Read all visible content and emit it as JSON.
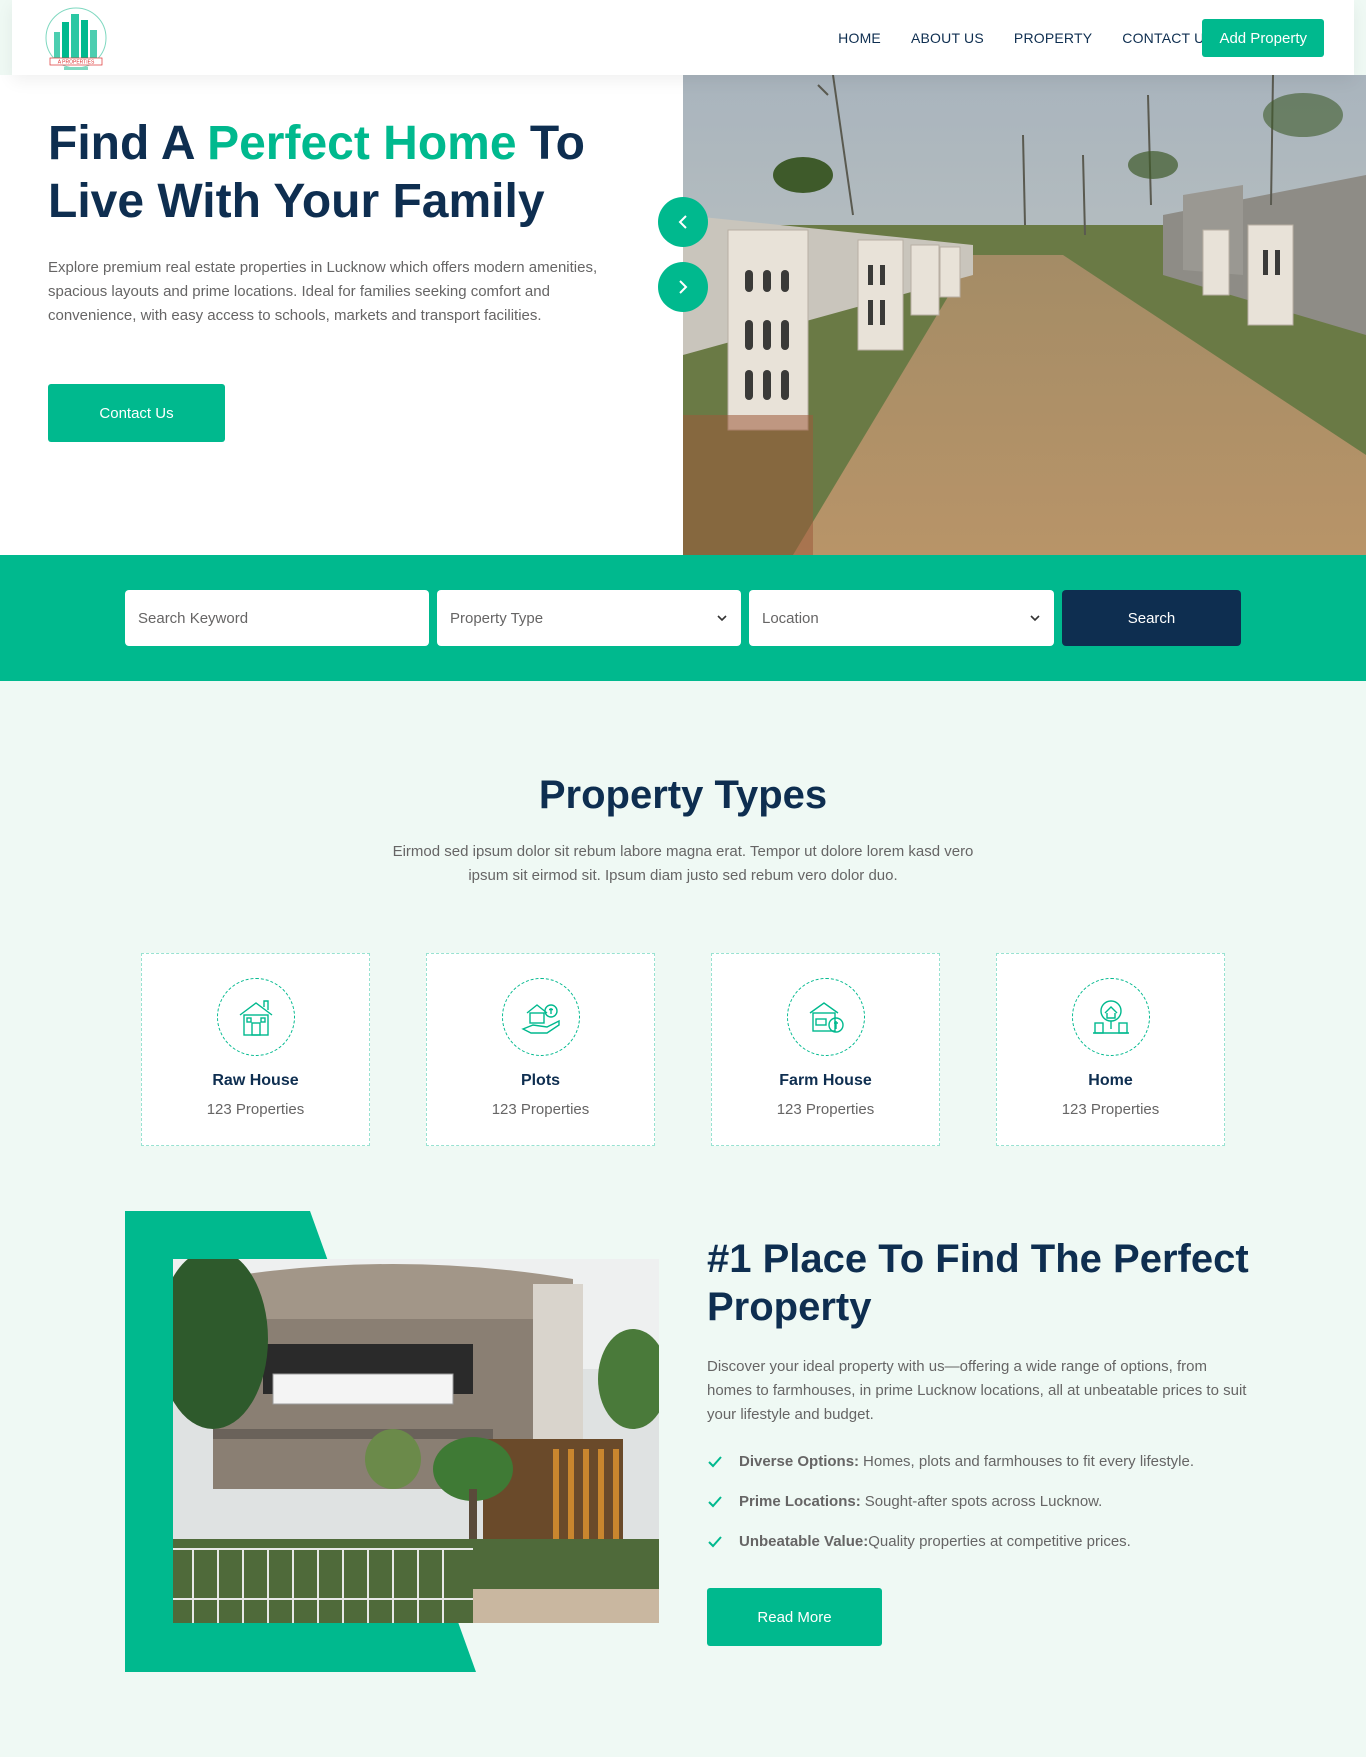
{
  "nav": {
    "logo_text": "A PROPERTIES",
    "links": [
      "HOME",
      "ABOUT US",
      "PROPERTY",
      "CONTACT US"
    ],
    "cta": "Add Property"
  },
  "hero": {
    "title_part1": "Find A ",
    "title_accent": "Perfect Home",
    "title_part2": " To Live With Your Family",
    "description": "Explore premium real estate properties in Lucknow which offers modern amenities, spacious layouts and prime locations. Ideal for families seeking comfort and convenience, with easy access to schools, markets and transport facilities.",
    "button": "Contact Us"
  },
  "search": {
    "keyword_placeholder": "Search Keyword",
    "type_placeholder": "Property Type",
    "location_placeholder": "Location",
    "button": "Search"
  },
  "property_types": {
    "title": "Property Types",
    "subtitle": "Eirmod sed ipsum dolor sit rebum labore magna erat. Tempor ut dolore lorem kasd vero ipsum sit eirmod sit. Ipsum diam justo sed rebum vero dolor duo.",
    "cards": [
      {
        "name": "Raw House",
        "count": "123 Properties",
        "icon": "house-icon"
      },
      {
        "name": "Plots",
        "count": "123 Properties",
        "icon": "plot-icon"
      },
      {
        "name": "Farm House",
        "count": "123 Properties",
        "icon": "farmhouse-icon"
      },
      {
        "name": "Home",
        "count": "123 Properties",
        "icon": "home-icon"
      }
    ]
  },
  "about": {
    "title": "#1 Place To Find The Perfect Property",
    "description": "Discover your ideal property with us—offering a wide range of options, from homes to farmhouses, in prime Lucknow locations, all at unbeatable prices to suit your lifestyle and budget.",
    "points": [
      {
        "bold": "Diverse Options:",
        "text": "Homes, plots and farmhouses to fit every lifestyle."
      },
      {
        "bold": "Prime Locations:",
        "text": "Sought-after spots across Lucknow."
      },
      {
        "bold": "Unbeatable Value:",
        "text": "Quality properties at competitive prices."
      }
    ],
    "button": "Read More"
  },
  "colors": {
    "primary": "#00b98e",
    "dark": "#0e2e50",
    "text": "#666565",
    "bg": "#eff9f4"
  }
}
